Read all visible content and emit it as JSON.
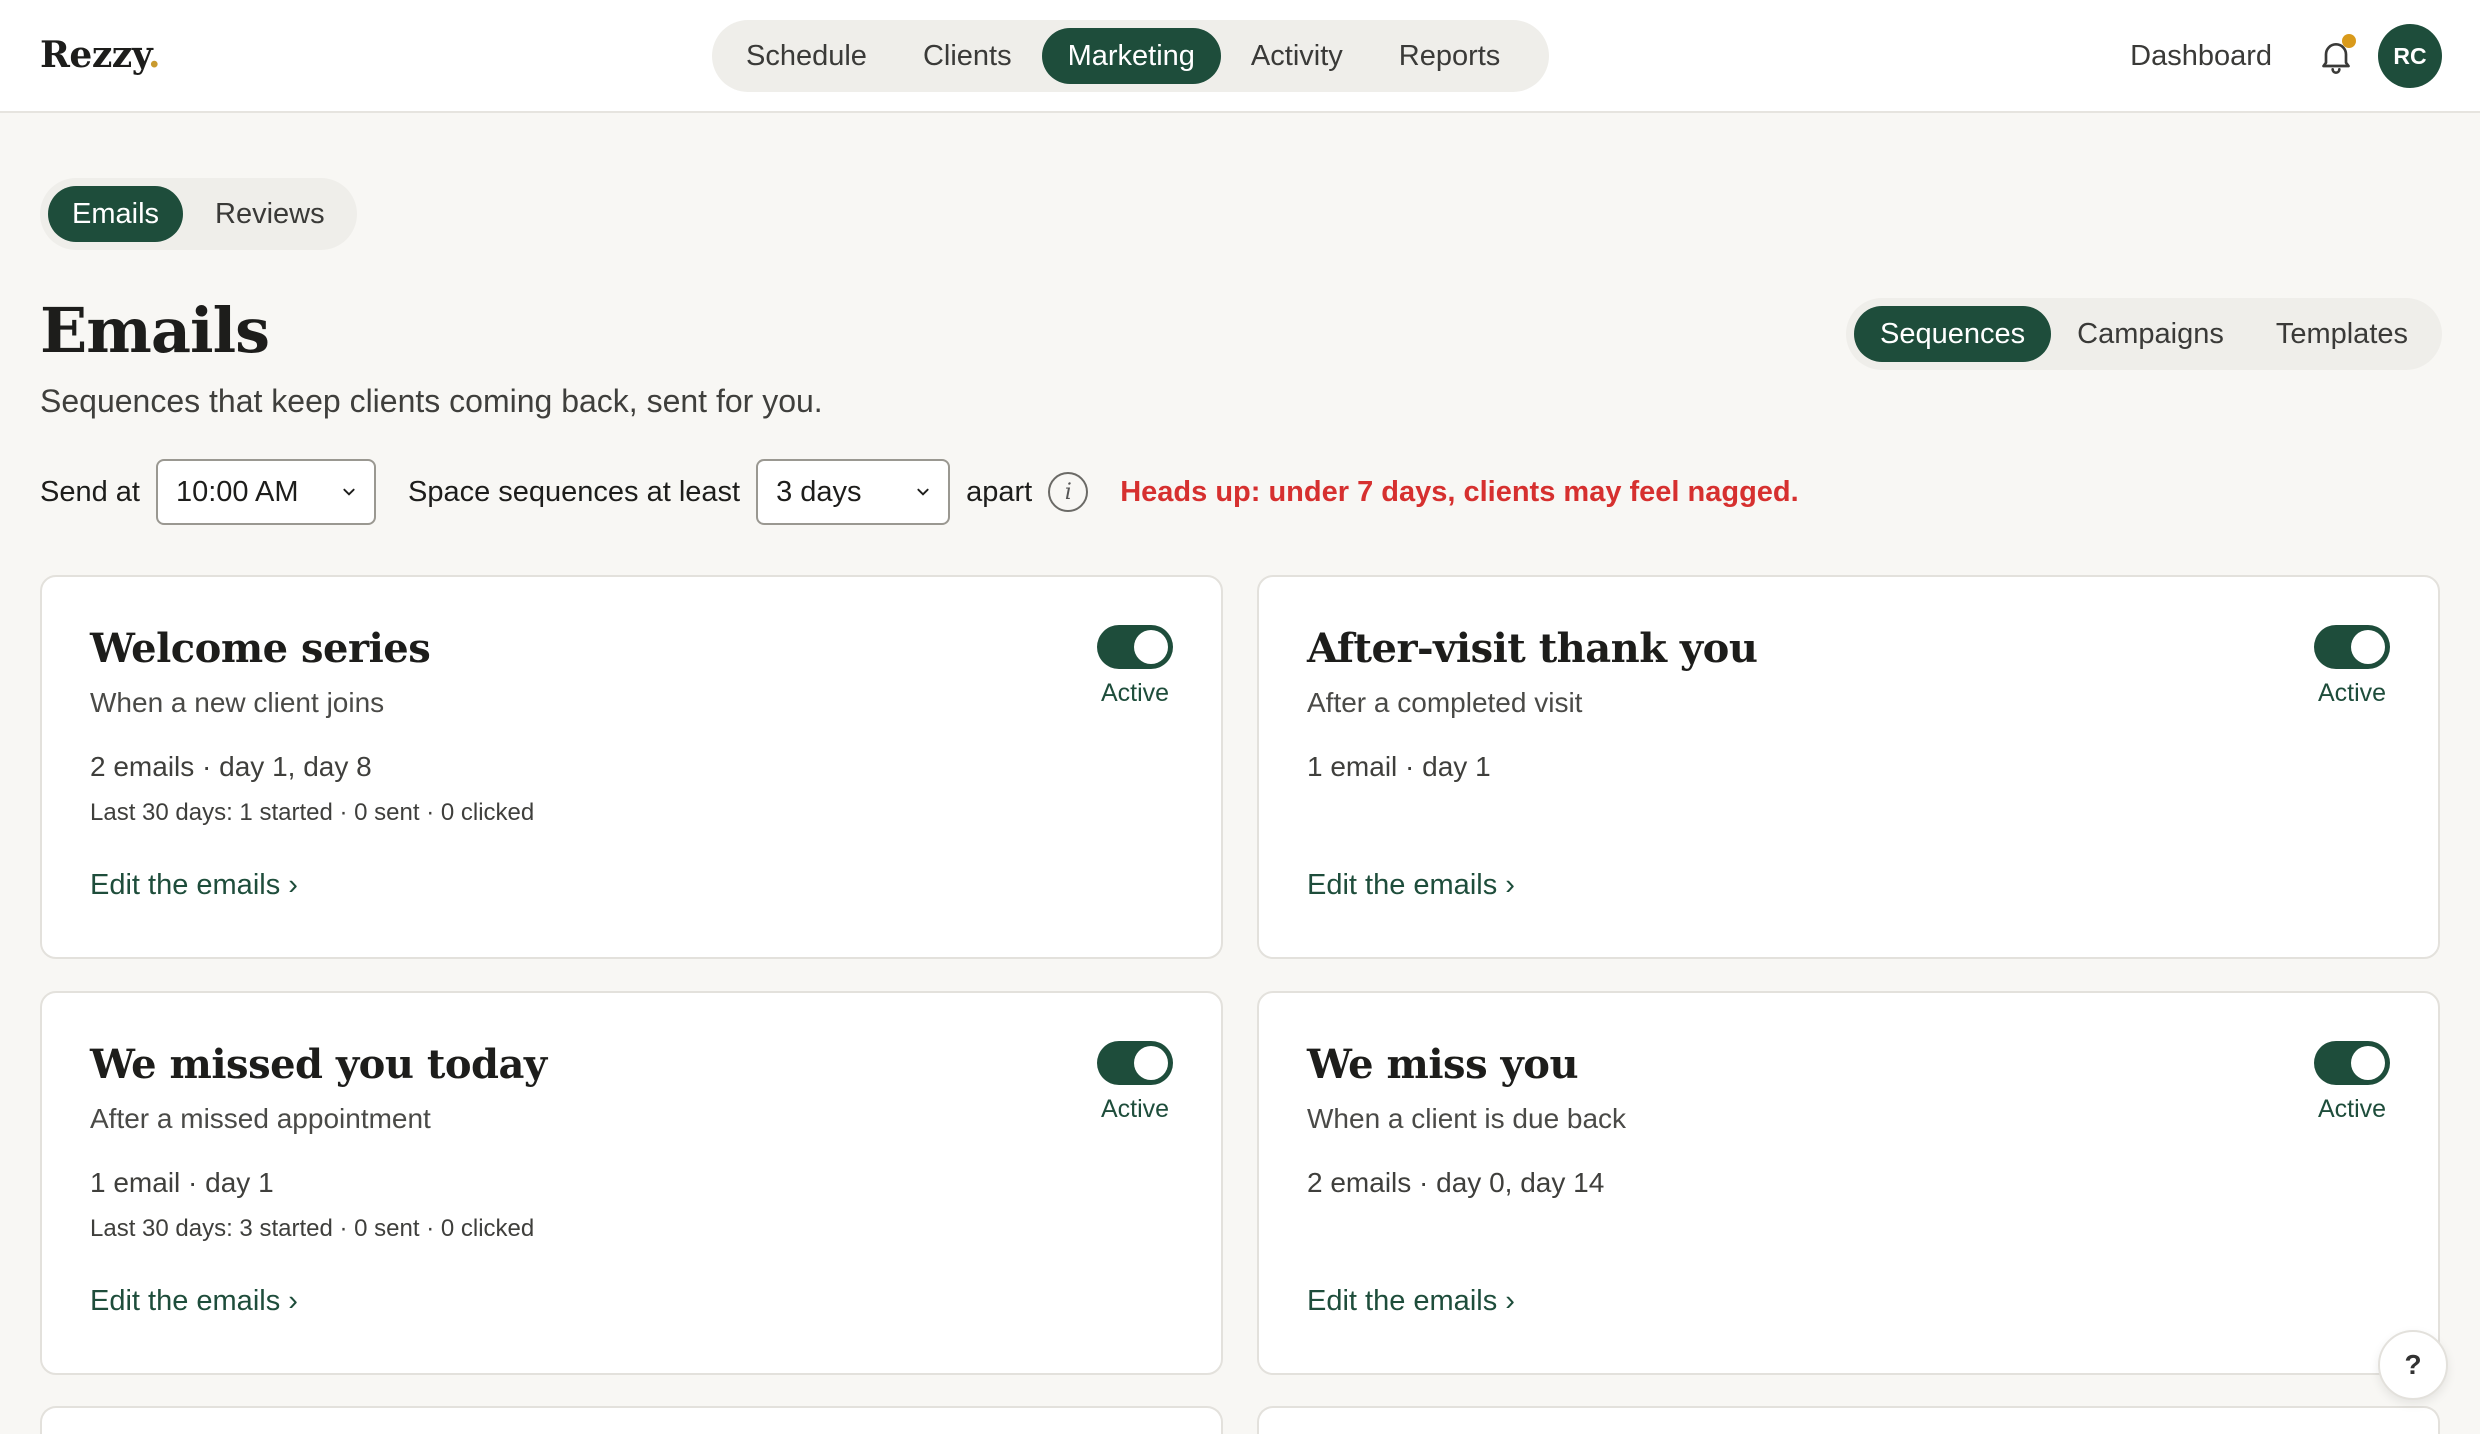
{
  "app": {
    "logo": "Rezzy",
    "logo_dot": "."
  },
  "nav": {
    "tabs": [
      {
        "label": "Schedule",
        "active": false
      },
      {
        "label": "Clients",
        "active": false
      },
      {
        "label": "Marketing",
        "active": true
      },
      {
        "label": "Activity",
        "active": false
      },
      {
        "label": "Reports",
        "active": false
      }
    ],
    "dashboard_label": "Dashboard",
    "avatar_initials": "RC"
  },
  "subtabs": [
    {
      "label": "Emails",
      "active": true
    },
    {
      "label": "Reviews",
      "active": false
    }
  ],
  "page": {
    "title": "Emails",
    "subtitle": "Sequences that keep clients coming back, sent for you."
  },
  "view_tabs": [
    {
      "label": "Sequences",
      "active": true
    },
    {
      "label": "Campaigns",
      "active": false
    },
    {
      "label": "Templates",
      "active": false
    }
  ],
  "settings": {
    "send_at_label": "Send at",
    "send_at_value": "10:00 AM",
    "space_label": "Space sequences at least",
    "space_value": "3 days",
    "apart_label": "apart",
    "info_glyph": "i",
    "warning": "Heads up: under 7 days, clients may feel nagged."
  },
  "cards": [
    {
      "title": "Welcome series",
      "trigger": "When a new client joins",
      "count": "2 emails · day 1, day 8",
      "stats": "Last 30 days: 1 started · 0 sent · 0 clicked",
      "status": "Active",
      "edit": "Edit the emails ›"
    },
    {
      "title": "After-visit thank you",
      "trigger": "After a completed visit",
      "count": "1 email · day 1",
      "stats": "",
      "status": "Active",
      "edit": "Edit the emails ›"
    },
    {
      "title": "We missed you today",
      "trigger": "After a missed appointment",
      "count": "1 email · day 1",
      "stats": "Last 30 days: 3 started · 0 sent · 0 clicked",
      "status": "Active",
      "edit": "Edit the emails ›"
    },
    {
      "title": "We miss you",
      "trigger": "When a client is due back",
      "count": "2 emails · day 0, day 14",
      "stats": "",
      "status": "Active",
      "edit": "Edit the emails ›"
    }
  ],
  "help_label": "?",
  "colors": {
    "brand": "#1e4d3b",
    "warning": "#d6302f",
    "badge": "#d99a1b"
  },
  "icons": [
    "bell-icon",
    "chevron-down-icon",
    "info-icon",
    "help-icon"
  ]
}
